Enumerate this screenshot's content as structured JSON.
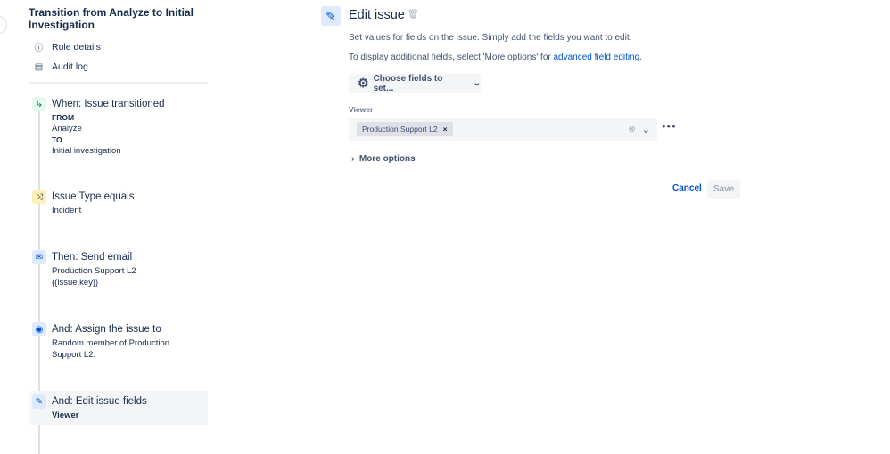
{
  "sidebar": {
    "title": "Transition from Analyze to Initial Investigation",
    "nav": [
      {
        "label": "Rule details",
        "icon": "info-icon"
      },
      {
        "label": "Audit log",
        "icon": "document-icon"
      }
    ]
  },
  "steps": [
    {
      "title": "When: Issue transitioned",
      "lines": [
        "FROM",
        "Analyze",
        "TO",
        "Initial investigation"
      ],
      "icon": "transition-icon",
      "color": "#e3fcef"
    },
    {
      "title": "Issue Type equals",
      "lines": [
        "Incident"
      ],
      "icon": "shuffle-icon",
      "color": "#fff0b3"
    },
    {
      "title": "Then: Send email",
      "lines": [
        "Production Support L2",
        "{{issue.key}}"
      ],
      "icon": "email-icon",
      "color": "#deebff"
    },
    {
      "title": "And: Assign the issue to",
      "lines": [
        "Random member of Production",
        "Support L2."
      ],
      "icon": "user-icon",
      "color": "#deebff"
    },
    {
      "title": "And: Edit issue fields",
      "lines": [
        "Viewer"
      ],
      "icon": "pencil-icon",
      "color": "#deebff"
    }
  ],
  "editor": {
    "title": "Edit issue",
    "desc1": "Set values for fields on the issue. Simply add the fields you want to edit.",
    "desc2_pre": "To display additional fields, select 'More options' for ",
    "desc2_link": "advanced field editing",
    "desc2_post": ".",
    "choose_label": "Choose fields to set...",
    "field_label": "Viewer",
    "tag": "Production Support L2",
    "more_options": "More options",
    "cancel": "Cancel",
    "save": "Save",
    "link_color": "#0052cc"
  }
}
